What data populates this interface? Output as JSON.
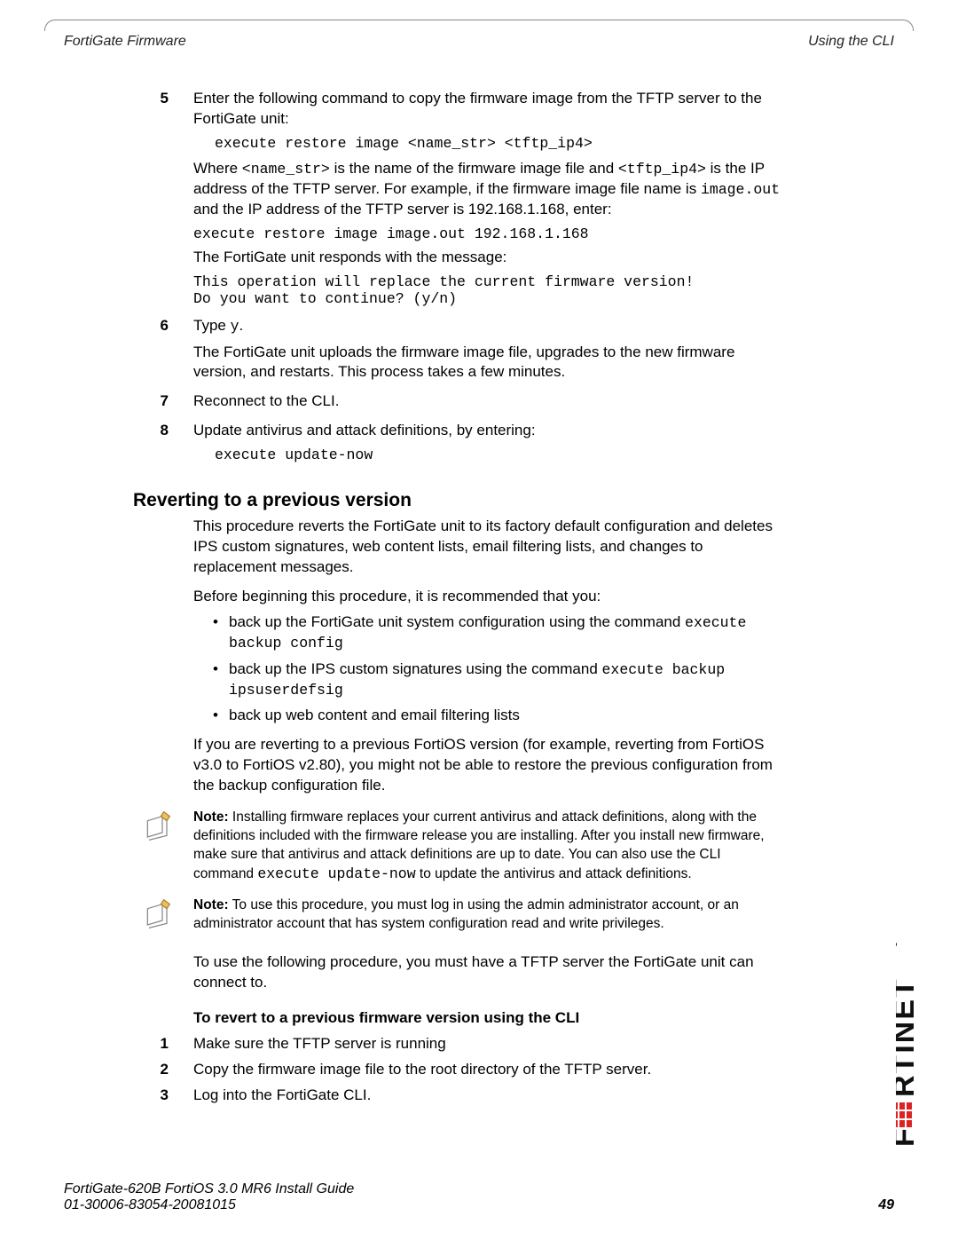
{
  "header": {
    "left": "FortiGate Firmware",
    "right": "Using the CLI"
  },
  "steps_a": [
    {
      "num": "5",
      "text": "Enter the following command to copy the firmware image from the TFTP server to the FortiGate unit:",
      "code1": "execute restore image <name_str> <tftp_ip4>",
      "where_a": "Where ",
      "where_code1": "<name_str>",
      "where_b": " is the name of the firmware image file and ",
      "where_code2": "<tftp_ip4>",
      "where_c": " is the IP address of the TFTP server. For example, if the firmware image file name is ",
      "where_code3": "image.out",
      "where_d": " and the IP address of the TFTP server is 192.168.1.168, enter:",
      "code2": "execute restore image image.out 192.168.1.168",
      "resp_intro": "The FortiGate unit responds with the message:",
      "resp_l1": "This operation will replace the current firmware version!",
      "resp_l2": "Do you want to continue? (y/n)"
    },
    {
      "num": "6",
      "text_a": "Type ",
      "text_code": "y",
      "text_b": ".",
      "text2": "The FortiGate unit uploads the firmware image file, upgrades to the new firmware version, and restarts. This process takes a few minutes."
    },
    {
      "num": "7",
      "text": "Reconnect to the CLI."
    },
    {
      "num": "8",
      "text": "Update antivirus and attack definitions, by entering:",
      "code": "execute update-now"
    }
  ],
  "section": {
    "title": "Reverting to a previous version",
    "p1": "This procedure reverts the FortiGate unit to its factory default configuration and deletes IPS custom signatures, web content lists, email filtering lists, and changes to replacement messages.",
    "p2": "Before beginning this procedure, it is recommended that you:",
    "bullets": [
      {
        "text": "back up the FortiGate unit system configuration using the command ",
        "code": "execute backup config"
      },
      {
        "text": "back up the IPS custom signatures using the command ",
        "code": "execute backup ipsuserdefsig"
      },
      {
        "text": "back up web content and email filtering lists"
      }
    ],
    "p3": "If you are reverting to a previous FortiOS version (for example, reverting from FortiOS v3.0 to FortiOS v2.80), you might not be able to restore the previous configuration from the backup configuration file.",
    "note1": {
      "label": "Note:",
      "text_a": " Installing firmware replaces your current antivirus and attack definitions, along with the definitions included with the firmware release you are installing. After you install new firmware, make sure that antivirus and attack definitions are up to date. You can also use the CLI command ",
      "code": "execute update-now",
      "text_b": " to update the antivirus and attack definitions."
    },
    "note2": {
      "label": "Note:",
      "text": " To use this procedure, you must log in using the admin administrator account, or an administrator account that has system configuration read and write privileges."
    },
    "p4": "To use the following procedure, you must have a TFTP server the FortiGate unit can connect to.",
    "subheading": "To revert to a previous firmware version using the CLI"
  },
  "steps_b": [
    {
      "num": "1",
      "text": "Make sure the TFTP server is running"
    },
    {
      "num": "2",
      "text": "Copy the firmware image file to the root directory of the TFTP server."
    },
    {
      "num": "3",
      "text": "Log into the FortiGate CLI."
    }
  ],
  "footer": {
    "line1": "FortiGate-620B FortiOS 3.0 MR6 Install Guide",
    "line2": "01-30006-83054-20081015",
    "page": "49"
  }
}
